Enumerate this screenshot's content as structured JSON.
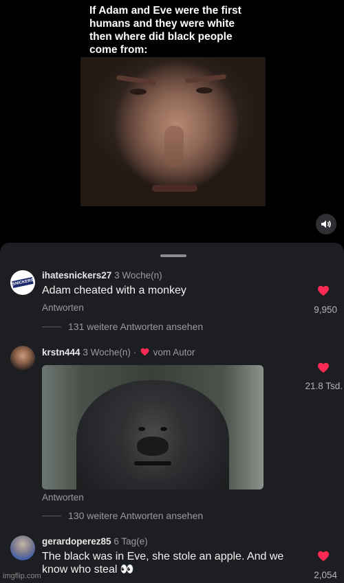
{
  "video": {
    "caption": "If Adam and Eve were the first\nhumans and they were white\nthen where did black people\ncome from:",
    "sound_icon": "speaker-icon"
  },
  "comments": [
    {
      "username": "ihatesnickers27",
      "age": "3 Woche(n)",
      "text": "Adam cheated with a monkey",
      "reply": "Antworten",
      "more_replies": "131 weitere Antworten ansehen",
      "likes": "9,950",
      "avatar_text": "SNICKERS"
    },
    {
      "username": "krstn444",
      "age": "3 Woche(n) ·",
      "author_badge": "vom Autor",
      "reply": "Antworten",
      "more_replies": "130 weitere Antworten ansehen",
      "likes": "21.8 Tsd."
    },
    {
      "username": "gerardoperez85",
      "age": "6 Tag(e)",
      "text": "The black was in Eve, she stole an apple. And we know who steal 👀",
      "likes": "2,054"
    }
  ],
  "colors": {
    "sheet": "#1d1e22",
    "heart": "#fe2c55"
  },
  "watermark": "imgflip.com"
}
